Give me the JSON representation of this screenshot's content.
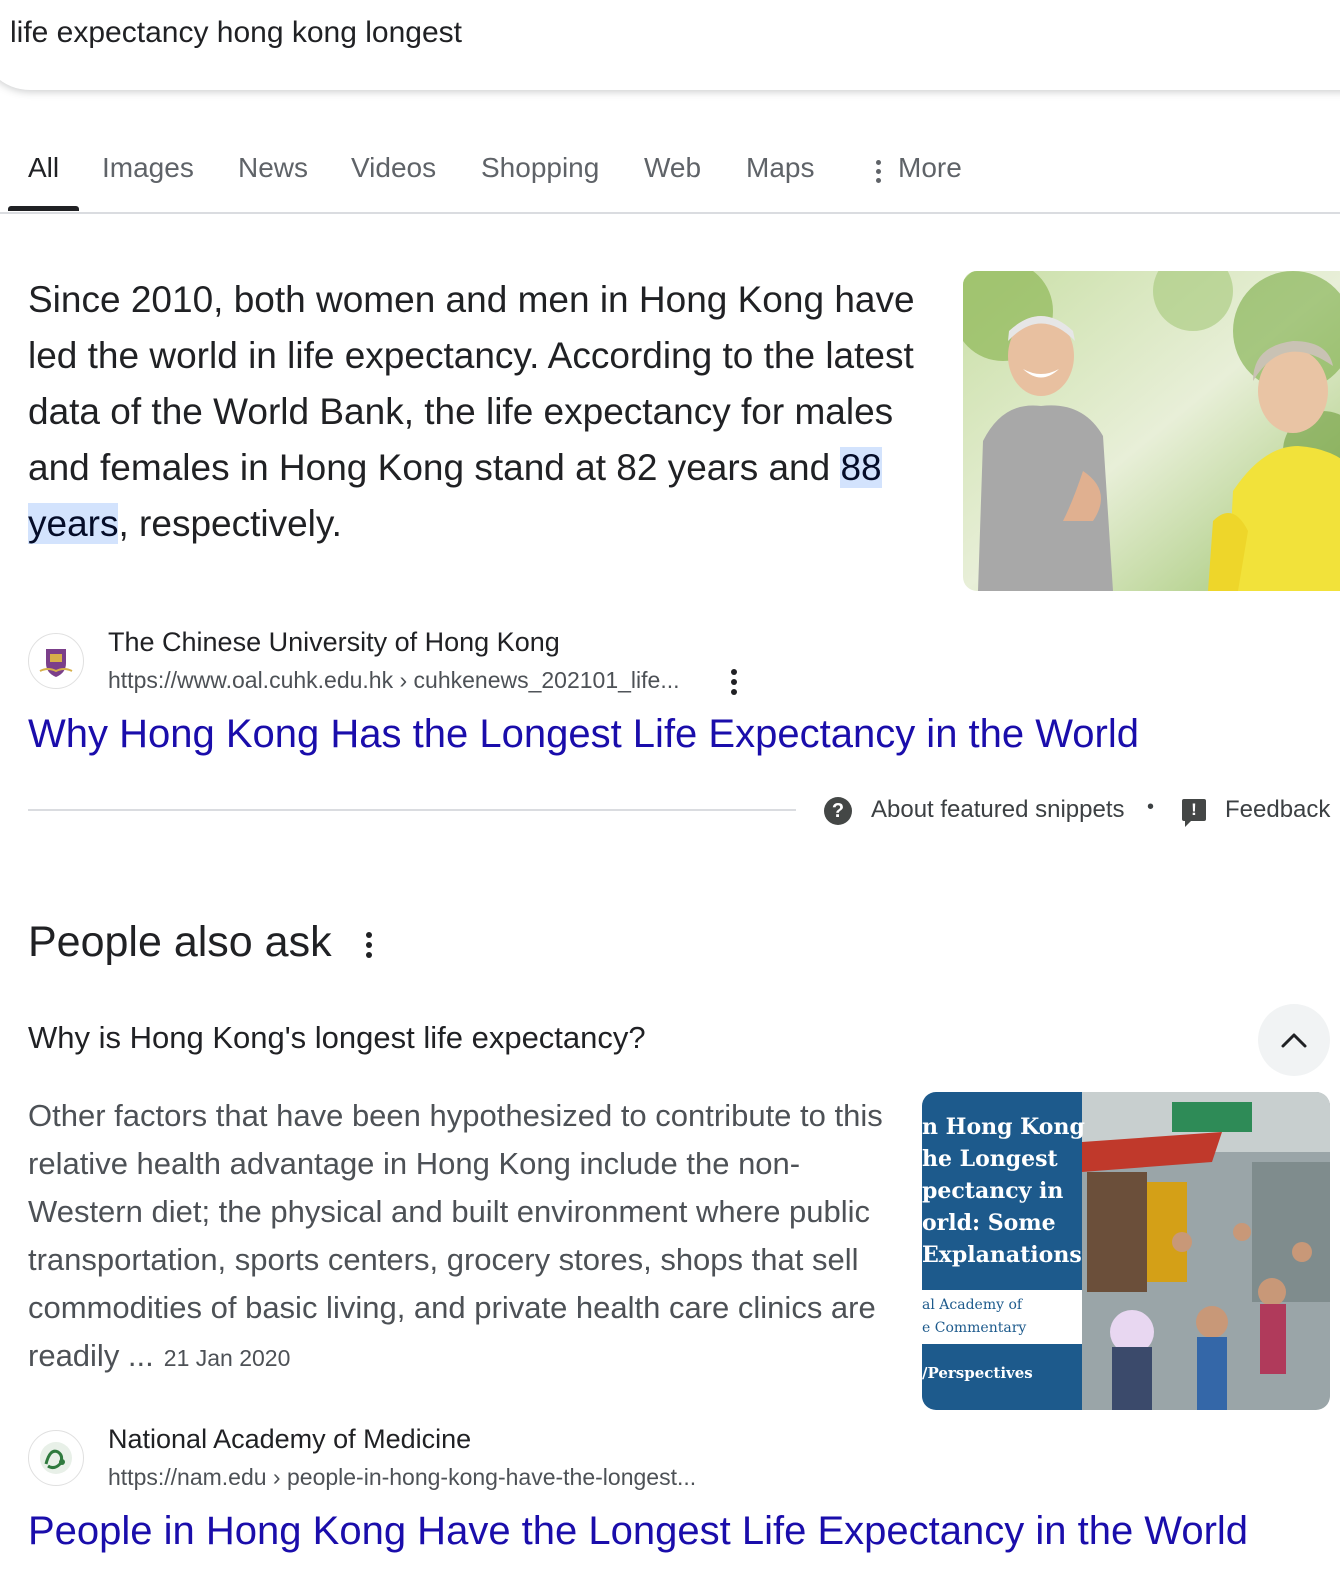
{
  "search": {
    "query": "life expectancy hong kong longest"
  },
  "tabs": [
    {
      "label": "All",
      "active": true
    },
    {
      "label": "Images"
    },
    {
      "label": "News"
    },
    {
      "label": "Videos"
    },
    {
      "label": "Shopping"
    },
    {
      "label": "Web"
    },
    {
      "label": "Maps"
    },
    {
      "label": "More"
    }
  ],
  "featured_snippet": {
    "text_before": "Since 2010, both women and men in Hong Kong have led the world in life expectancy. According to the latest data of the World Bank, the life expectancy for males and females in Hong Kong stand at 82 years and ",
    "highlight": "88 years",
    "text_after": ", respectively.",
    "source_name": "The Chinese University of Hong Kong",
    "source_url": "https://www.oal.cuhk.edu.hk › cuhkenews_202101_life...",
    "title": "Why Hong Kong Has the Longest Life Expectancy in the World",
    "about_label": "About featured snippets",
    "separator": "•",
    "feedback_label": "Feedback"
  },
  "people_also_ask": {
    "heading": "People also ask",
    "question": "Why is Hong Kong's longest life expectancy?",
    "answer": "Other factors that have been hypothesized to contribute to this relative health advantage in Hong Kong include the non-Western diet; the physical and built environment where public transportation, sports centers, grocery stores, shops that sell commodities of basic living, and private health care clinics are readily ...",
    "date": "21 Jan 2020",
    "image_text": {
      "line1": "n Hong Kong",
      "line2": "he Longest",
      "line3": "pectancy in",
      "line4": "orld: Some",
      "line5": "Explanations",
      "line6": "al Academy of",
      "line7": "e Commentary",
      "line8": "/Perspectives"
    },
    "source_name": "National Academy of Medicine",
    "source_url": "https://nam.edu › people-in-hong-kong-have-the-longest...",
    "title": "People in Hong Kong Have the Longest Life Expectancy in the World"
  },
  "colors": {
    "link": "#1a0dab",
    "highlight_bg": "#d3e3fd",
    "text": "#202124",
    "secondary_text": "#4d5156"
  }
}
